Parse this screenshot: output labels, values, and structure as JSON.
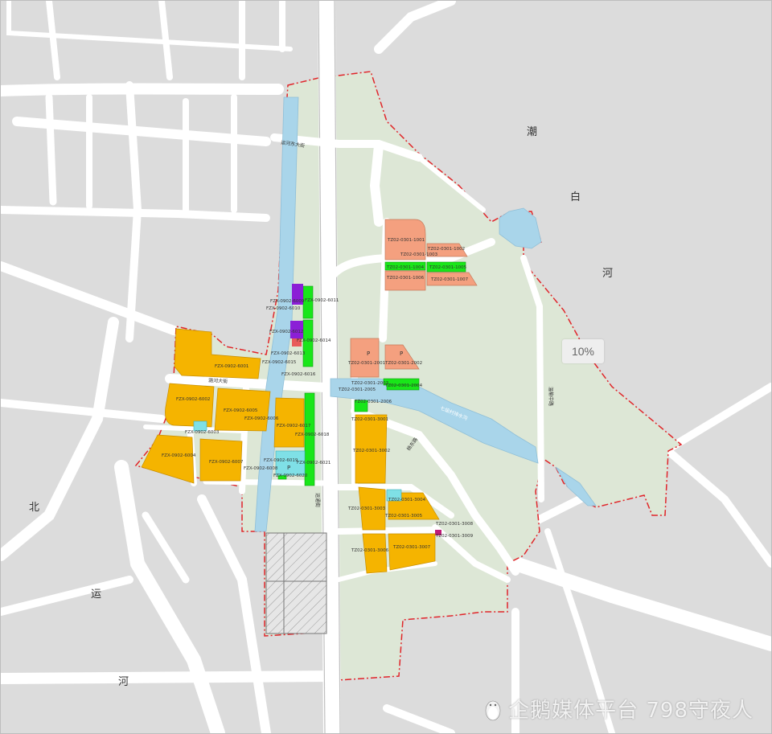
{
  "map": {
    "zoom_label": "10%",
    "watermark": "企鹅媒体平台 798守夜人",
    "place_labels": {
      "chao": "潮",
      "bai": "白",
      "he1": "河",
      "bei": "北",
      "yun": "运",
      "he2": "河"
    },
    "road_labels": {
      "top": "运河东大街",
      "mid": "潞河大街",
      "canal": "七级村排水沟",
      "east_road": "温榆中路",
      "south": "运通街",
      "tz": "杨东路"
    },
    "parcels": {
      "p1001": "TZ02-0301-1001",
      "p1002": "TZ02-0301-1002",
      "p1003": "TZ02-0301-1003",
      "p1004": "TZ02-0301-1004",
      "p1005": "TZ02-0301-1005",
      "p1006": "TZ02-0301-1006",
      "p1007": "TZ02-0301-1007",
      "p2001": "TZ02-0301-2001",
      "p2002": "TZ02-0301-2002",
      "p2003": "TZ02-0301-2003",
      "p2004": "TZ02-0301-2004",
      "p2005": "TZ02-0301-2005",
      "p2006": "TZ02-0301-2006",
      "p3001": "TZ02-0301-3001",
      "p3002": "TZ02-0301-3002",
      "p3003": "TZ02-0301-3003",
      "p3004": "TZ02-0301-3004",
      "p3005": "TZ02-0301-3005",
      "p3006": "TZ02-0301-3006",
      "p3007": "TZ02-0301-3007",
      "p3008": "TZ02-0301-3008",
      "p3009": "TZ02-0301-3009",
      "f6001": "FZX-0902-6001",
      "f6002": "FZX-0902-6002",
      "f6003": "FZX-0902-6003",
      "f6004": "FZX-0902-6004",
      "f6005": "FZX-0902-6005",
      "f6006": "FZX-0902-6006",
      "f6007": "FZX-0902-6007",
      "f6008": "FZX-0902-6008",
      "f6009": "FZX-0902-6009",
      "f6010": "FZX-0902-6010",
      "f6011": "FZX-0902-6011",
      "f6012": "FZX-0902-6012",
      "f6013": "FZX-0902-6013",
      "f6014": "FZX-0902-6014",
      "f6015": "FZX-0902-6015",
      "f6016": "FZX-0902-6016",
      "f6017": "FZX-0902-6017",
      "f6018": "FZX-0902-6018",
      "f6019": "FZX-0902-6019",
      "f6020": "FZX-0902-6020",
      "f6021": "FZX-0902-6021",
      "p_mark": "P"
    },
    "colors": {
      "background": "#dcdcdc",
      "road": "#ffffff",
      "green_land": "#dde7d6",
      "residential": "#f5b400",
      "commercial": "#f4a07f",
      "park": "#19e619",
      "water": "#a9d5ea",
      "education": "#8b1fd6",
      "boundary": "#e0252a"
    }
  }
}
